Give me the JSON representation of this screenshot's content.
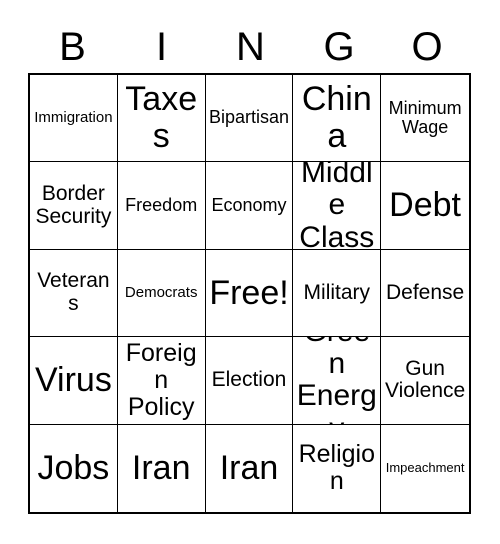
{
  "header": {
    "letters": [
      "B",
      "I",
      "N",
      "G",
      "O"
    ]
  },
  "grid": {
    "rows": [
      [
        {
          "label": "Immigration",
          "size": "fs-s"
        },
        {
          "label": "Taxes",
          "size": "fs-huge"
        },
        {
          "label": "Bipartisan",
          "size": "fs-m"
        },
        {
          "label": "China",
          "size": "fs-huge"
        },
        {
          "label": "Minimum Wage",
          "size": "fs-m"
        }
      ],
      [
        {
          "label": "Border Security",
          "size": "fs-l"
        },
        {
          "label": "Freedom",
          "size": "fs-m"
        },
        {
          "label": "Economy",
          "size": "fs-m"
        },
        {
          "label": "Middle Class",
          "size": "fs-xxl"
        },
        {
          "label": "Debt",
          "size": "fs-huge"
        }
      ],
      [
        {
          "label": "Veterans",
          "size": "fs-l"
        },
        {
          "label": "Democrats",
          "size": "fs-s"
        },
        {
          "label": "Free!",
          "size": "fs-huge"
        },
        {
          "label": "Military",
          "size": "fs-l"
        },
        {
          "label": "Defense",
          "size": "fs-l"
        }
      ],
      [
        {
          "label": "Virus",
          "size": "fs-huge"
        },
        {
          "label": "Foreign Policy",
          "size": "fs-xl"
        },
        {
          "label": "Election",
          "size": "fs-l"
        },
        {
          "label": "Green Energy",
          "size": "fs-xxl"
        },
        {
          "label": "Gun Violence",
          "size": "fs-l"
        }
      ],
      [
        {
          "label": "Jobs",
          "size": "fs-huge"
        },
        {
          "label": "Iran",
          "size": "fs-huge"
        },
        {
          "label": "Iran",
          "size": "fs-huge"
        },
        {
          "label": "Religion",
          "size": "fs-xl"
        },
        {
          "label": "Impeachment",
          "size": "fs-xs"
        }
      ]
    ]
  },
  "colors": {
    "background": "#ffffff",
    "text": "#000000",
    "border": "#000000"
  }
}
